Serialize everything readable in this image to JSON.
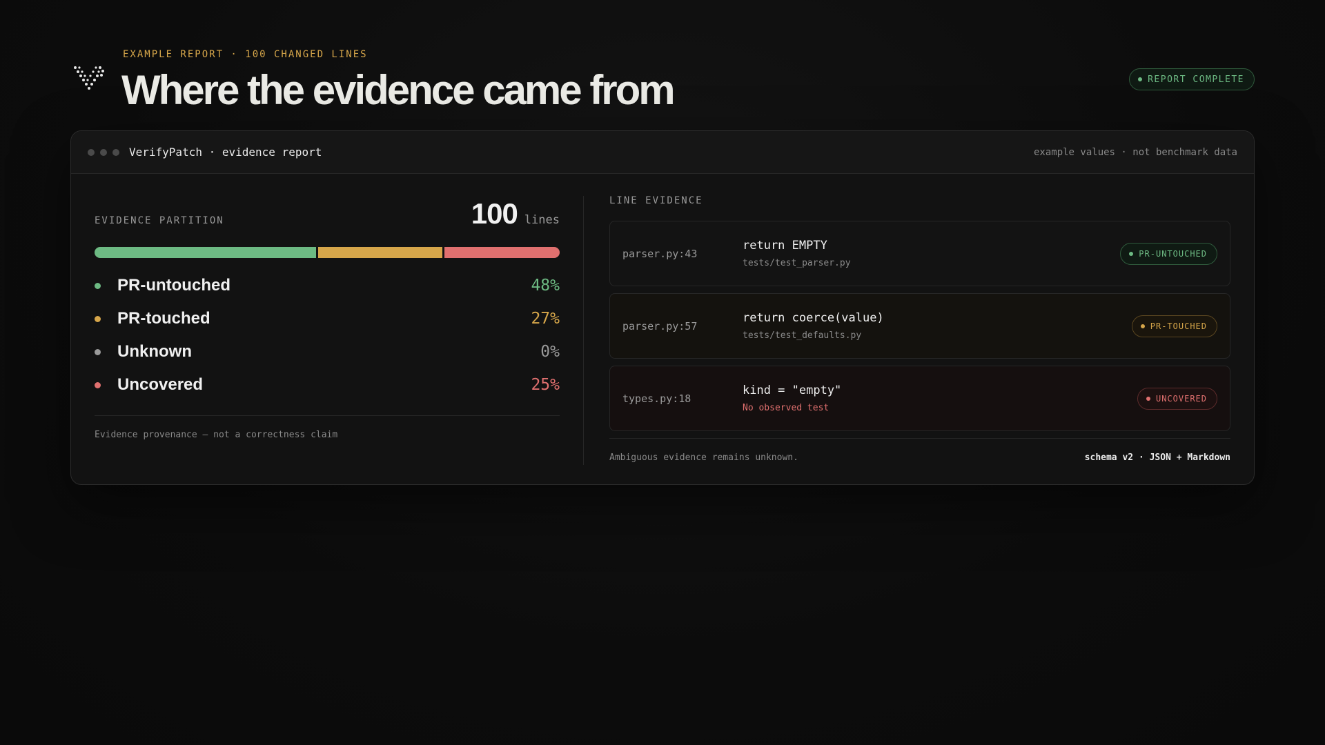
{
  "header": {
    "eyebrow": "EXAMPLE REPORT · 100 CHANGED LINES",
    "title": "Where the evidence came from",
    "status": "REPORT COMPLETE",
    "logo_icon": "vp-logo-icon"
  },
  "window": {
    "title": "VerifyPatch · evidence report",
    "note": "example values · not benchmark data"
  },
  "partition": {
    "label": "EVIDENCE PARTITION",
    "total": "100",
    "total_unit": "lines",
    "footnote": "Evidence provenance — not a correctness claim",
    "items": [
      {
        "label": "PR-untouched",
        "value": "48%",
        "percent": 48,
        "color": "#6dba83"
      },
      {
        "label": "PR-touched",
        "value": "27%",
        "percent": 27,
        "color": "#d6a64a"
      },
      {
        "label": "Unknown",
        "value": "0%",
        "percent": 0,
        "color": "#9a9a9a"
      },
      {
        "label": "Uncovered",
        "value": "25%",
        "percent": 25,
        "color": "#e0706f"
      }
    ]
  },
  "evidence": {
    "label": "LINE EVIDENCE",
    "rows": [
      {
        "location": "parser.py:43",
        "code": "return EMPTY",
        "detail": "tests/test_parser.py",
        "badge": "PR-UNTOUCHED"
      },
      {
        "location": "parser.py:57",
        "code": "return coerce(value)",
        "detail": "tests/test_defaults.py",
        "badge": "PR-TOUCHED"
      },
      {
        "location": "types.py:18",
        "code": "kind = \"empty\"",
        "detail": "No observed test",
        "badge": "UNCOVERED"
      }
    ],
    "footer_left": "Ambiguous evidence remains unknown.",
    "footer_right": "schema v2 · JSON + Markdown"
  }
}
